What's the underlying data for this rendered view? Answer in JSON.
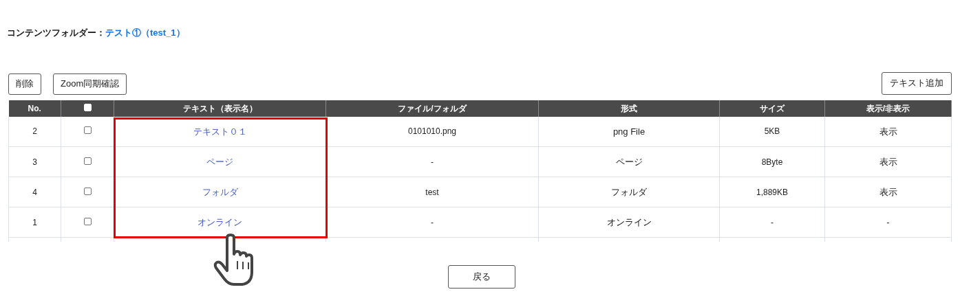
{
  "header": {
    "label": "コンテンツフォルダー：",
    "folder_link": "テスト①（test_1）"
  },
  "toolbar": {
    "left_buttons": [
      "削除",
      "Zoom同期確認"
    ],
    "right_button": "テキスト追加"
  },
  "table": {
    "columns": [
      "No.",
      "テキスト（表示名）",
      "ファイル/フォルダ",
      "形式",
      "サイズ",
      "表示/非表示"
    ],
    "select_all": {
      "checked": false
    },
    "rows": [
      {
        "no": "2",
        "checked": false,
        "text": "テキスト０１",
        "file": "0101010.png",
        "format": "png File",
        "size": "5KB",
        "visibility": "表示"
      },
      {
        "no": "3",
        "checked": false,
        "text": "ページ",
        "file": "-",
        "format": "ページ",
        "size": "8Byte",
        "visibility": "表示"
      },
      {
        "no": "4",
        "checked": false,
        "text": "フォルダ",
        "file": "test",
        "format": "フォルダ",
        "size": "1,889KB",
        "visibility": "表示"
      },
      {
        "no": "1",
        "checked": false,
        "text": "オンライン",
        "file": "-",
        "format": "オンライン",
        "size": "-",
        "visibility": "-"
      }
    ]
  },
  "back_button": "戻る"
}
